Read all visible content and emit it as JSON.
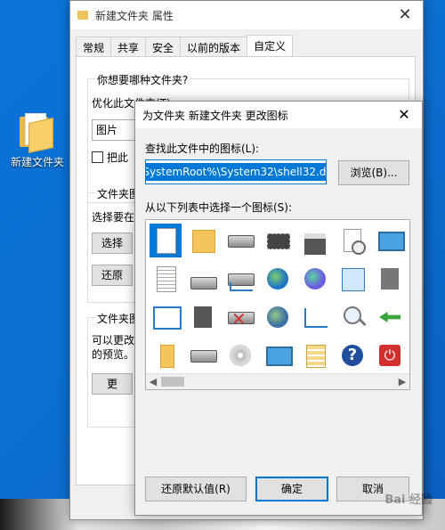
{
  "desktop": {
    "folder_label": "新建文件夹"
  },
  "props_window": {
    "title": "新建文件夹 属性",
    "tabs": [
      "常规",
      "共享",
      "安全",
      "以前的版本",
      "自定义"
    ],
    "background": {
      "group_title": "你想要哪种文件夹?",
      "optimize_label": "优化此文件夹(T):",
      "optimize_value": "图片",
      "check_label": "把此",
      "group2_title": "文件夹图",
      "group2_text": "选择要在",
      "btn_choose": "选择",
      "btn_restore": "还原",
      "group3_title": "文件夹图",
      "group3_text1": "可以更改",
      "group3_text2": "的预览。",
      "btn_change": "更"
    }
  },
  "change_icon_dialog": {
    "title": "为文件夹 新建文件夹 更改图标",
    "find_label": "查找此文件中的图标(L):",
    "path_value": "%SystemRoot%\\System32\\shell32.dll",
    "browse_button": "浏览(B)...",
    "list_label": "从以下列表中选择一个图标(S):",
    "icons": [
      [
        "blank-document-icon",
        "folder-icon",
        "removable-drive-icon",
        "memory-chip-icon",
        "printer-icon",
        "document-clock-icon",
        "monitor-display-icon",
        "hand-share-icon",
        "recycle-bin-icon"
      ],
      [
        "text-document-icon",
        "server-drive-icon",
        "network-drive-icon",
        "internet-globe-icon",
        "network-globe-icon",
        "control-panel-icon",
        "shortcut-app-icon",
        "shortcut-arrow-icon",
        "document-icon-partial"
      ],
      [
        "window-icon",
        "floppy-drive-icon",
        "disconnected-drive-icon",
        "mouse-globe-icon",
        "network-connections-icon",
        "search-icon",
        "green-arrow-drive-icon",
        "blue-book-icon"
      ],
      [
        "folder-small-icon",
        "hard-drive-icon",
        "cd-drive-icon",
        "computer-icon",
        "grid-document-icon",
        "help-question-icon",
        "power-icon",
        "full-recycle-bin-icon",
        "mixed-document-icon"
      ]
    ],
    "restore_default_button": "还原默认值(R)",
    "ok_button": "确定",
    "cancel_button": "取消"
  },
  "watermark": "Bai 经验"
}
